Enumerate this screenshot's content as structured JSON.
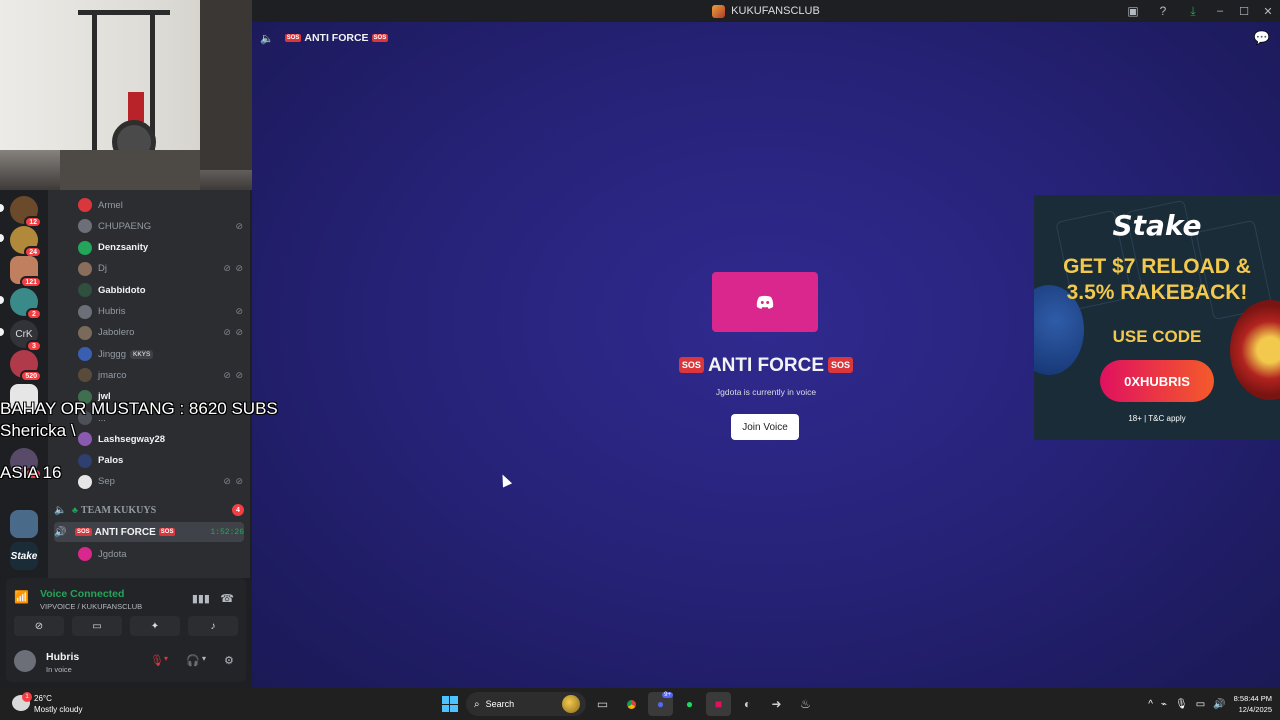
{
  "window": {
    "title": "KUKUFANSCLUB"
  },
  "rail": {
    "servers": [
      {
        "badge": "12"
      },
      {
        "badge": "24"
      },
      {
        "badge": "121"
      },
      {
        "badge": "2"
      },
      {
        "label": "CrK",
        "badge": "3"
      },
      {
        "badge": "520"
      },
      {
        "badge": ""
      },
      {
        "badge": "20"
      },
      {
        "badge": ""
      },
      {
        "label": "Stake",
        "badge": ""
      }
    ]
  },
  "members": [
    {
      "name": "Armel",
      "active": false,
      "status": "",
      "color": "#da373c"
    },
    {
      "name": "CHUPAENG",
      "active": false,
      "status": "⊘",
      "color": "#6c6f78"
    },
    {
      "name": "Denzsanity",
      "active": true,
      "status": "",
      "color": "#23a55a"
    },
    {
      "name": "Dj",
      "active": false,
      "status": "⊘ ⊘",
      "color": "#8a6d5a"
    },
    {
      "name": "Gabbidoto",
      "active": true,
      "status": "",
      "color": "#2f4f3f"
    },
    {
      "name": "Hubris",
      "active": false,
      "status": "⊘",
      "color": "#6c6f78"
    },
    {
      "name": "Jabolero",
      "active": false,
      "status": "⊘ ⊘",
      "color": "#7a6a5a"
    },
    {
      "name": "Jinggg",
      "active": false,
      "status": "",
      "tag": "KKYS",
      "color": "#3a5fb0"
    },
    {
      "name": "jmarco",
      "active": false,
      "status": "⊘ ⊘",
      "color": "#5a4a3a"
    },
    {
      "name": "jwl",
      "active": true,
      "status": "",
      "color": "#3f6f4f"
    },
    {
      "name": "...",
      "active": false,
      "status": "",
      "color": "#4e5058"
    },
    {
      "name": "Lashsegway28",
      "active": true,
      "status": "",
      "color": "#8a5ab0"
    },
    {
      "name": "Palos",
      "active": true,
      "status": "",
      "color": "#2f3f6f"
    },
    {
      "name": "Sep",
      "active": false,
      "status": "⊘ ⊘",
      "color": "#e6e6e6"
    }
  ],
  "voice_channels": {
    "team": {
      "name": "TEAM KUKUYS",
      "count": "4"
    },
    "anti": {
      "name": "ANTI FORCE",
      "sos": "SOS",
      "timer": "1:52:26"
    },
    "anti_member": {
      "name": "Jgdota"
    }
  },
  "overlay": {
    "line1": "BAHAY OR MUSTANG : 8620 SUBS",
    "line2": "Shericka \\",
    "line3": "ASIA 16"
  },
  "voice_panel": {
    "status": "Voice Connected",
    "location": "VIPVOICE / KUKUFANSCLUB",
    "user": "Hubris",
    "user_status": "In voice"
  },
  "main": {
    "channel": "ANTI FORCE",
    "sos": "SOS",
    "title": "ANTI FORCE",
    "subtitle": "Jgdota is currently in voice",
    "join_label": "Join Voice"
  },
  "ad": {
    "brand": "Stake",
    "line1": "GET $7 RELOAD &",
    "line2": "3.5% RAKEBACK!",
    "code_label": "USE CODE",
    "code": "0XHUBRIS",
    "fine": "18+ | T&C apply"
  },
  "taskbar": {
    "temp": "26°C",
    "weather": "Mostly cloudy",
    "weather_badge": "1",
    "search": "Search",
    "discord_badge": "9+",
    "time": "8:58:44 PM",
    "date": "12/4/2025"
  }
}
